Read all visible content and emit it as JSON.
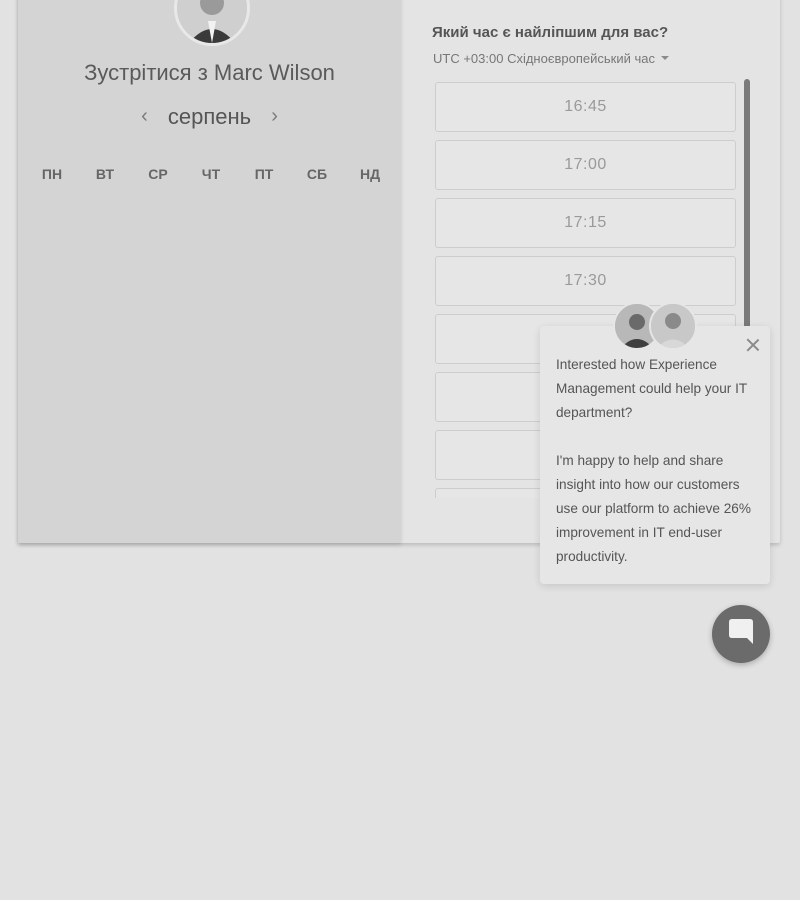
{
  "booking": {
    "title": "Зустрітися з Marc Wilson",
    "month": "серпень",
    "weekdays": [
      "ПН",
      "ВТ",
      "СР",
      "ЧТ",
      "ПТ",
      "СБ",
      "НД"
    ],
    "time_prompt": "Який час є найліпшим для вас?",
    "timezone": "UTC +03:00 Східноєвропейський час",
    "slots": [
      "16:45",
      "17:00",
      "17:15",
      "17:30",
      "",
      "",
      "",
      ""
    ]
  },
  "popup": {
    "paragraph1": "Interested how Experience Management could help your IT department?",
    "paragraph2": "I'm happy to help and share insight into how our customers use our platform to achieve 26% improvement in IT end-user productivity."
  },
  "icons": {
    "prev": "chevron-left-icon",
    "next": "chevron-right-icon",
    "close": "close-icon",
    "chat": "chat-bubble-icon"
  }
}
